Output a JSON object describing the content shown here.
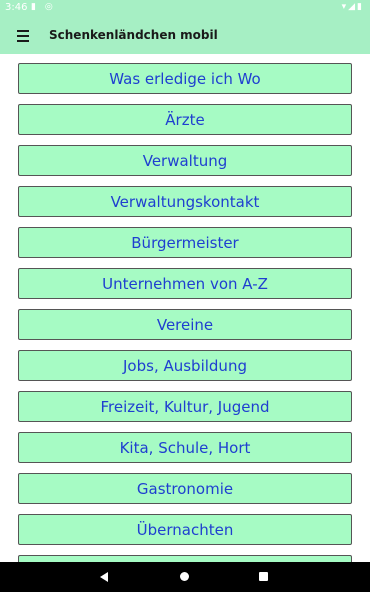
{
  "status": {
    "time": "3:46",
    "left_icons": "▮ ◎",
    "right_icons": "▾◢▮"
  },
  "app_bar": {
    "title": "Schenkenländchen mobil",
    "menu_icon": "hamburger-menu"
  },
  "menu_items": [
    "Was erledige ich Wo",
    "Ärzte",
    "Verwaltung",
    "Verwaltungskontakt",
    "Bürgermeister",
    "Unternehmen von A-Z",
    "Vereine",
    "Jobs, Ausbildung",
    "Freizeit, Kultur, Jugend",
    "Kita, Schule, Hort",
    "Gastronomie",
    "Übernachten",
    ""
  ],
  "colors": {
    "app_bar": "#a6efc4",
    "button_bg": "#a6fbc4",
    "button_text": "#1f3fd0"
  }
}
